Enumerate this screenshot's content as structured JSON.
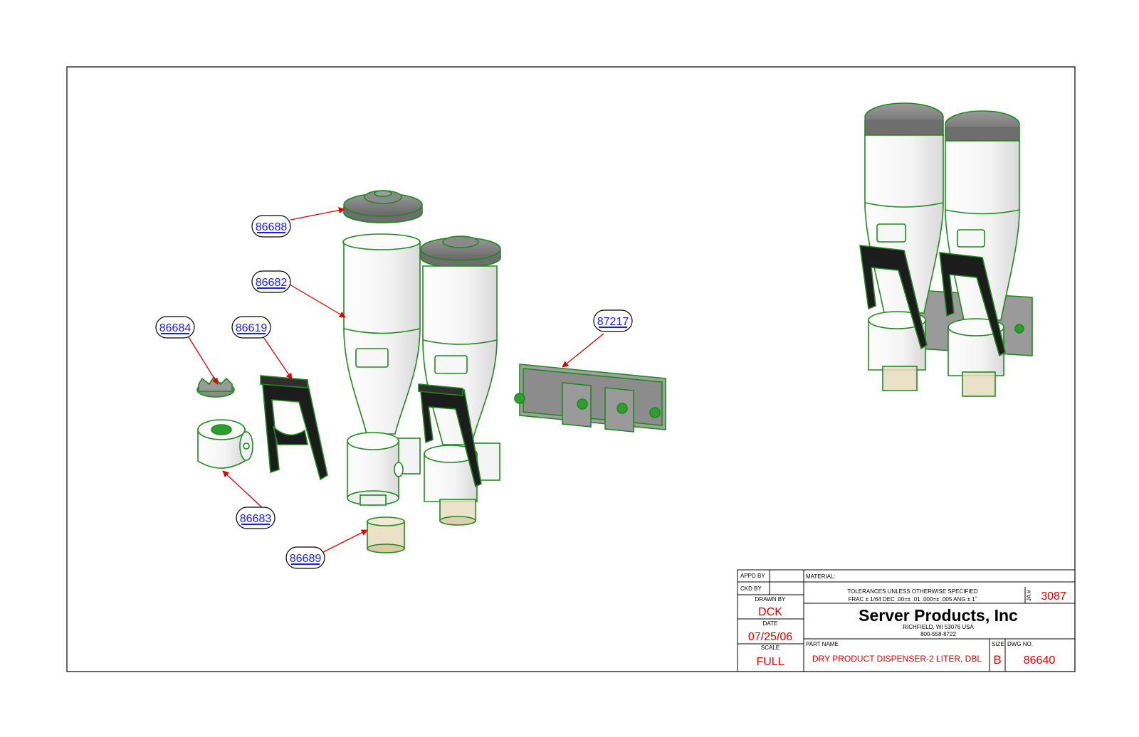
{
  "balloons": [
    {
      "id": "b1",
      "label": "86688"
    },
    {
      "id": "b2",
      "label": "86682"
    },
    {
      "id": "b3",
      "label": "86684"
    },
    {
      "id": "b4",
      "label": "86619"
    },
    {
      "id": "b5",
      "label": "87217"
    },
    {
      "id": "b6",
      "label": "86683"
    },
    {
      "id": "b7",
      "label": "86689"
    }
  ],
  "title_block": {
    "appd_by_label": "APPD BY",
    "ckd_by_label": "CKD BY",
    "drawn_by_label": "DRAWN BY",
    "drawn_by": "DCK",
    "date_label": "DATE",
    "date": "07/25/06",
    "scale_label": "SCALE",
    "scale": "FULL",
    "material_label": "MATERIAL:",
    "tolerances_line1": "TOLERANCES UNLESS OTHERWISE SPECIFIED",
    "tolerances_line2": "FRAC ± 1/64 DEC .00=± .01 .000=± .005 ANG ± 1˚",
    "ja_label": "JA #",
    "ja_number": "3087",
    "company": "Server Products, Inc",
    "address": "RICHFIELD, WI 53076 USA",
    "phone": "800-558-8722",
    "part_name_label": "PART NAME",
    "part_name": "DRY PRODUCT DISPENSER-2 LITER, DBL",
    "size_label": "SIZE",
    "size": "B",
    "dwg_no_label": "DWG NO.",
    "dwg_no": "86640"
  },
  "colors": {
    "outline_green": "#1e8a1e",
    "leader_red": "#e00000",
    "balloon_text_blue": "#1a1aff",
    "cap_gray": "#7a7a7a",
    "handle_black": "#1c1c1c",
    "cup_tan": "#e8dcc0",
    "bracket_gray": "#9a9a9a"
  }
}
